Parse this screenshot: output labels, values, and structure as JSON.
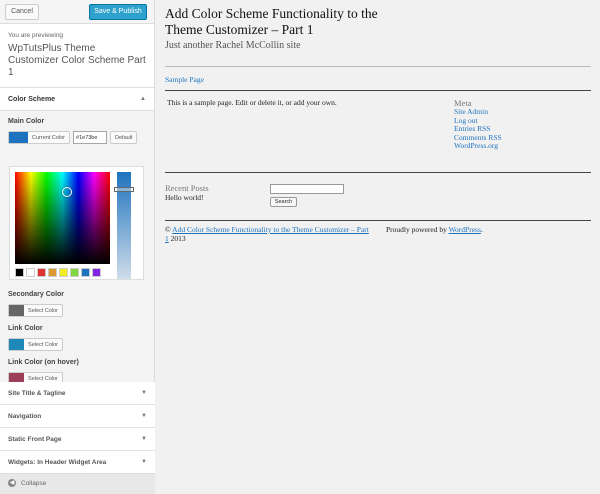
{
  "topbar": {
    "cancel_label": "Cancel",
    "save_label": "Save & Publish"
  },
  "preview_info": {
    "previewing": "You are previewing",
    "theme_name": "WpTutsPlus Theme Customizer Color Scheme Part 1"
  },
  "color_scheme": {
    "title": "Color Scheme",
    "main_color": {
      "label": "Main Color",
      "button": "Current Color",
      "hex": "#1e73be",
      "default": "Default",
      "value": "#1e73be"
    },
    "palette": [
      "#000000",
      "#ffffff",
      "#dd3333",
      "#dd9933",
      "#eeee22",
      "#81d742",
      "#1e73be",
      "#8224e3"
    ],
    "secondary_color": {
      "label": "Secondary Color",
      "button": "Select Color",
      "value": "#666666"
    },
    "link_color": {
      "label": "Link Color",
      "button": "Select Color",
      "value": "#1e88b8"
    },
    "link_hover_color": {
      "label": "Link Color (on hover)",
      "button": "Select Color",
      "value": "#9e3f5a"
    }
  },
  "sections": [
    "Site Title & Tagline",
    "Navigation",
    "Static Front Page",
    "Widgets: In Header Widget Area"
  ],
  "collapse_label": "Collapse",
  "site": {
    "title": "Add Color Scheme Functionality to the Theme Customizer – Part 1",
    "description": "Just another Rachel McCollin site",
    "nav": "Sample Page",
    "content": "This is a sample page. Edit or delete it, or add your own.",
    "meta_title": "Meta",
    "meta_links": [
      "Site Admin",
      "Log out",
      "Entries RSS",
      "Comments RSS",
      "WordPress.org"
    ],
    "recent_title": "Recent Posts",
    "recent_item": "Hello world!",
    "search_button": "Search",
    "footer_copy": "©",
    "footer_link": "Add Color Scheme Functionality to the Theme Customizer – Part 1",
    "footer_year": "2013",
    "footer_powered": "Proudly powered by",
    "footer_wp": "WordPress"
  }
}
